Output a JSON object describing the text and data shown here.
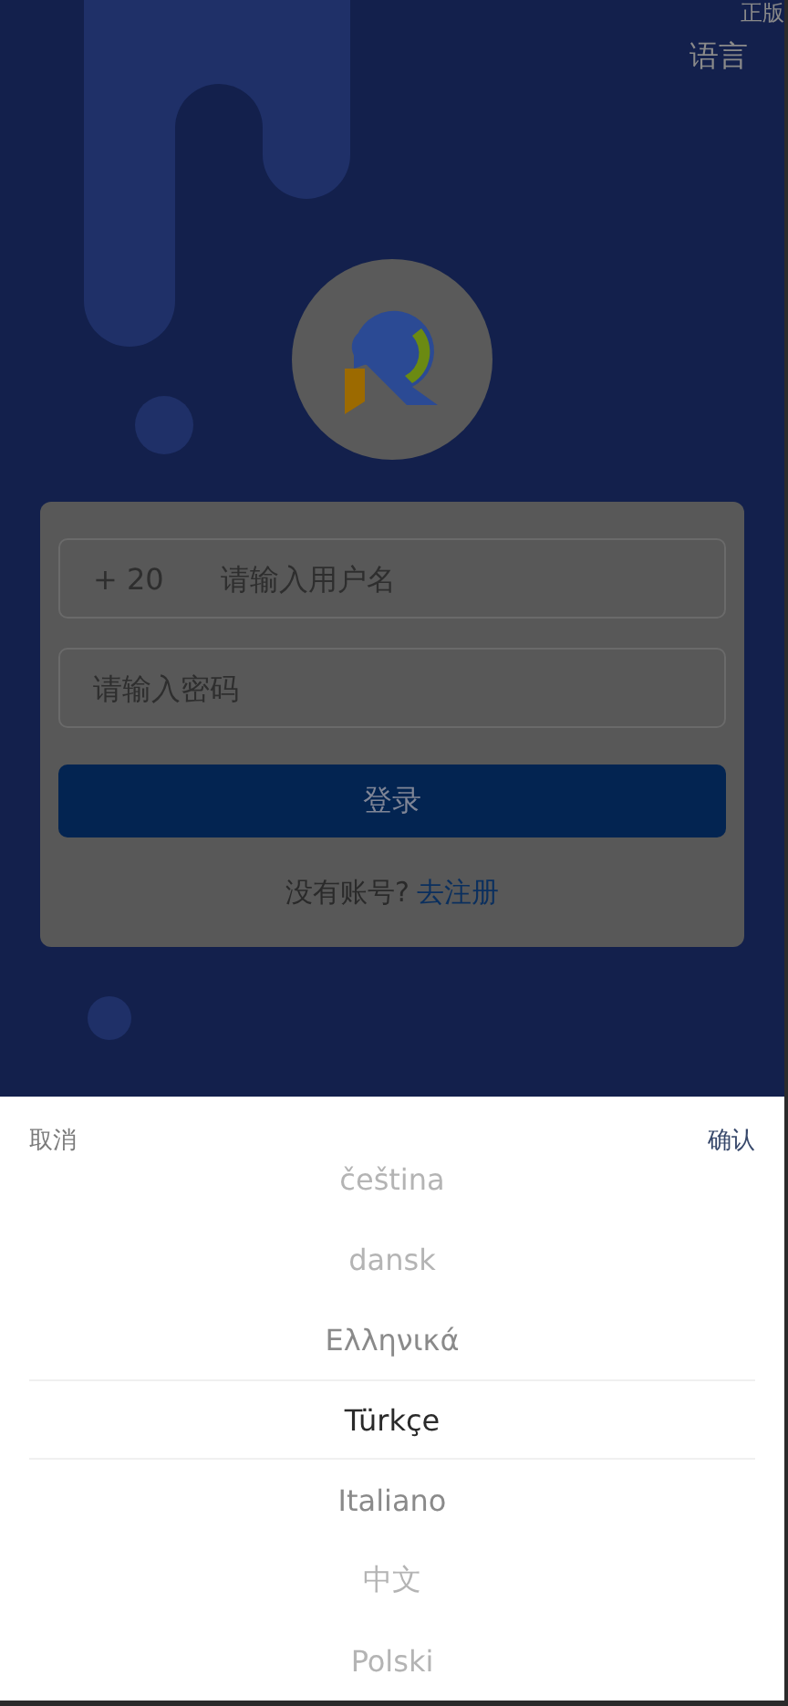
{
  "header": {
    "badge": "正版",
    "language_link": "语言"
  },
  "login_form": {
    "country_code": "+ 20",
    "username_placeholder": "请输入用户名",
    "password_placeholder": "请输入密码",
    "submit": "登录",
    "register_prompt": "没有账号?",
    "register_link": "去注册"
  },
  "language_picker": {
    "cancel": "取消",
    "confirm": "确认",
    "options": [
      {
        "label": "čeština",
        "selected": false
      },
      {
        "label": "dansk",
        "selected": false
      },
      {
        "label": "Ελληνικά",
        "selected": false
      },
      {
        "label": "Türkçe",
        "selected": true
      },
      {
        "label": "Italiano",
        "selected": false
      },
      {
        "label": "中文",
        "selected": false
      },
      {
        "label": "Polski",
        "selected": false
      }
    ]
  }
}
